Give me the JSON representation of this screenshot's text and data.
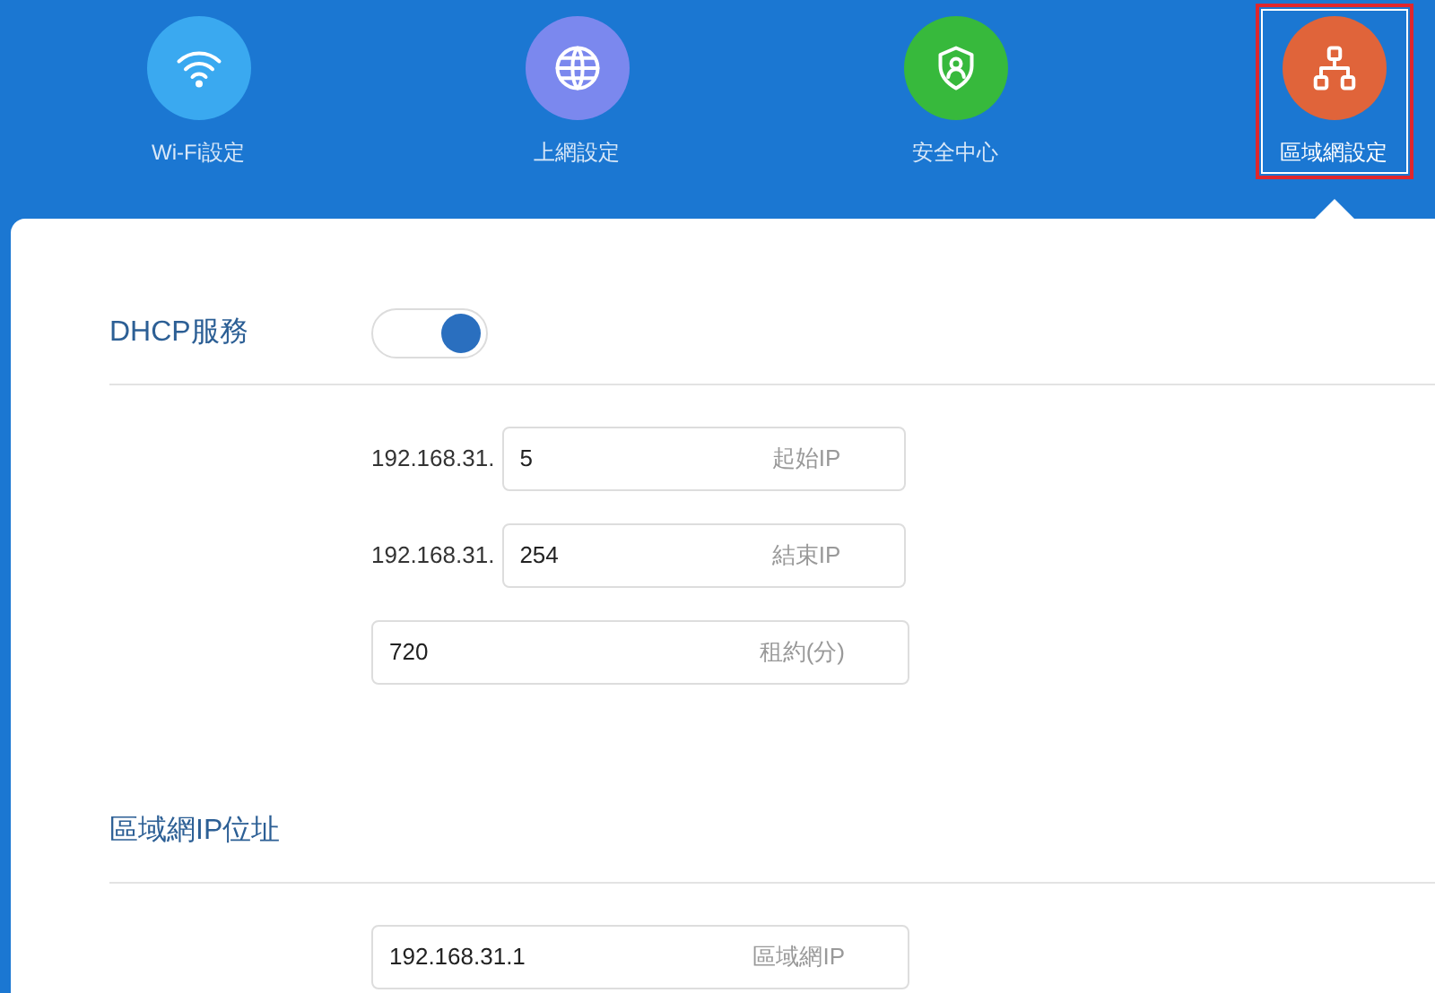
{
  "nav": [
    {
      "label": "Wi-Fi設定",
      "kind": "wifi",
      "color": "#3aa9f0",
      "selected": false
    },
    {
      "label": "上網設定",
      "kind": "globe",
      "color": "#7b88ee",
      "selected": false
    },
    {
      "label": "安全中心",
      "kind": "shield",
      "color": "#37b93c",
      "selected": false
    },
    {
      "label": "區域網設定",
      "kind": "network",
      "color": "#e0643a",
      "selected": true
    }
  ],
  "sections": [
    {
      "title": "DHCP服務",
      "toggle": {
        "on": true
      },
      "fields": [
        {
          "prefix": "192.168.31.",
          "value": "5",
          "label": "起始IP"
        },
        {
          "prefix": "192.168.31.",
          "value": "254",
          "label": "結束IP"
        },
        {
          "value": "720",
          "label": "租約(分)"
        }
      ]
    },
    {
      "title": "區域網IP位址",
      "fields": [
        {
          "value": "192.168.31.1",
          "label": "區域網IP"
        }
      ]
    }
  ]
}
